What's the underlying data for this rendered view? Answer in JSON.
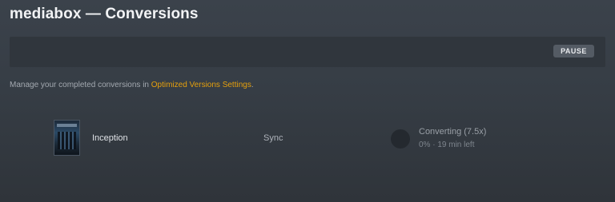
{
  "header": {
    "title": "mediabox — Conversions"
  },
  "toolbar": {
    "pause_label": "PAUSE"
  },
  "info": {
    "text_before": "Manage your completed conversions in ",
    "link_text": "Optimized Versions Settings",
    "text_after": ".",
    "link_color": "#e5a00d"
  },
  "conversions": [
    {
      "title": "Inception",
      "target": "Sync",
      "status": "Converting (7.5x)",
      "progress_text": "0% · 19 min left",
      "progress": 0
    }
  ],
  "icons": {
    "poster": "movie-poster-thumbnail",
    "progress": "progress-ring-icon"
  }
}
